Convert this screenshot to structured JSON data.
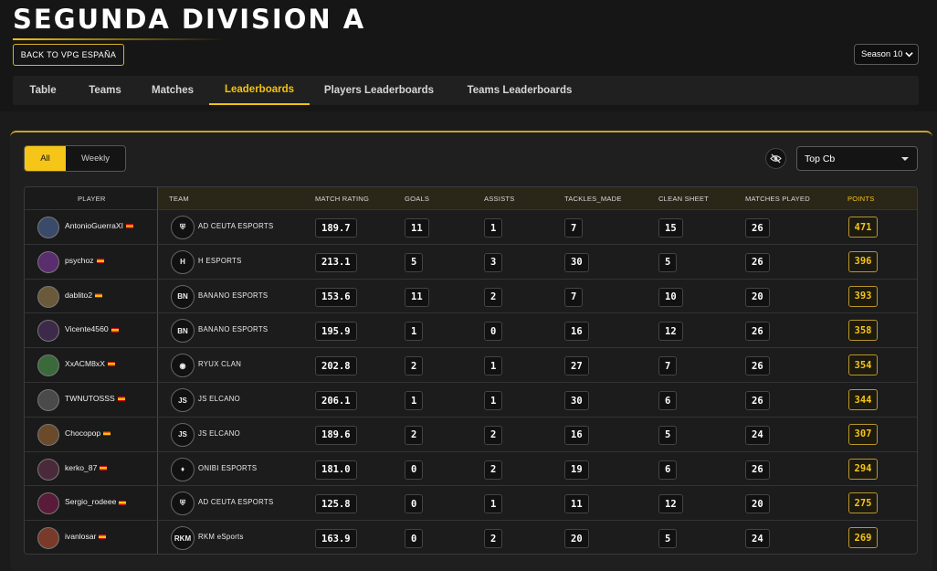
{
  "page": {
    "title": "SEGUNDA DIVISION A",
    "back_button": "BACK TO VPG ESPAÑA",
    "season": "Season 10"
  },
  "tabs": [
    "Table",
    "Teams",
    "Matches",
    "Leaderboards",
    "Players Leaderboards",
    "Teams Leaderboards"
  ],
  "active_tab": "Leaderboards",
  "filters": {
    "period_options": [
      "All",
      "Weekly"
    ],
    "period_selected": "All",
    "stat_selected": "Top Cb"
  },
  "colors": {
    "accent": "#f5c518",
    "background": "#1b1b1b"
  },
  "table": {
    "columns": [
      "PLAYER",
      "TEAM",
      "MATCH RATING",
      "GOALS",
      "ASSISTS",
      "TACKLES_MADE",
      "CLEAN SHEET",
      "MATCHES PLAYED",
      "POINTS"
    ],
    "rows": [
      {
        "player": "AntonioGuerraXI",
        "team": "AD CEUTA ESPORTS",
        "rating": "189.7",
        "goals": "11",
        "assists": "1",
        "tackles": "7",
        "clean_sheet": "15",
        "matches": "26",
        "points": "471"
      },
      {
        "player": "psychoz",
        "team": "H ESPORTS",
        "rating": "213.1",
        "goals": "5",
        "assists": "3",
        "tackles": "30",
        "clean_sheet": "5",
        "matches": "26",
        "points": "396"
      },
      {
        "player": "dablito2",
        "team": "BANANO ESPORTS",
        "rating": "153.6",
        "goals": "11",
        "assists": "2",
        "tackles": "7",
        "clean_sheet": "10",
        "matches": "20",
        "points": "393"
      },
      {
        "player": "Vicente4560",
        "team": "BANANO ESPORTS",
        "rating": "195.9",
        "goals": "1",
        "assists": "0",
        "tackles": "16",
        "clean_sheet": "12",
        "matches": "26",
        "points": "358"
      },
      {
        "player": "XxACM8xX",
        "team": "RYUX CLAN",
        "rating": "202.8",
        "goals": "2",
        "assists": "1",
        "tackles": "27",
        "clean_sheet": "7",
        "matches": "26",
        "points": "354"
      },
      {
        "player": "TWNUTOSSS",
        "team": "JS ELCANO",
        "rating": "206.1",
        "goals": "1",
        "assists": "1",
        "tackles": "30",
        "clean_sheet": "6",
        "matches": "26",
        "points": "344"
      },
      {
        "player": "Chocopop",
        "team": "JS ELCANO",
        "rating": "189.6",
        "goals": "2",
        "assists": "2",
        "tackles": "16",
        "clean_sheet": "5",
        "matches": "24",
        "points": "307"
      },
      {
        "player": "kerko_87",
        "team": "ONIBI ESPORTS",
        "rating": "181.0",
        "goals": "0",
        "assists": "2",
        "tackles": "19",
        "clean_sheet": "6",
        "matches": "26",
        "points": "294"
      },
      {
        "player": "Sergio_rodeee",
        "team": "AD CEUTA ESPORTS",
        "rating": "125.8",
        "goals": "0",
        "assists": "1",
        "tackles": "11",
        "clean_sheet": "12",
        "matches": "20",
        "points": "275"
      },
      {
        "player": "ivanlosar",
        "team": "RKM eSports",
        "rating": "163.9",
        "goals": "0",
        "assists": "2",
        "tackles": "20",
        "clean_sheet": "5",
        "matches": "24",
        "points": "269"
      }
    ]
  }
}
